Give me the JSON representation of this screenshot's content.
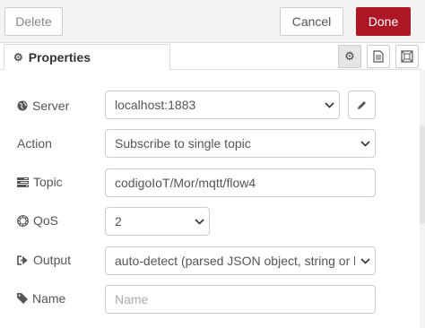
{
  "toolbar": {
    "delete_label": "Delete",
    "cancel_label": "Cancel",
    "done_label": "Done"
  },
  "tabs": {
    "properties_label": "Properties",
    "icons": [
      "gear-icon",
      "description-icon",
      "appearance-icon"
    ]
  },
  "form": {
    "server": {
      "label": "Server",
      "value": "localhost:1883",
      "icon": "globe-icon"
    },
    "action": {
      "label": "Action",
      "value": "Subscribe to single topic"
    },
    "topic": {
      "label": "Topic",
      "value": "codigoIoT/Mor/mqtt/flow4",
      "icon": "tasks-icon"
    },
    "qos": {
      "label": "QoS",
      "value": "2",
      "icon": "empire-icon"
    },
    "output": {
      "label": "Output",
      "value": "auto-detect (parsed JSON object, string or buffer)",
      "icon": "sign-out-icon"
    },
    "name": {
      "label": "Name",
      "placeholder": "Name",
      "value": "",
      "icon": "tag-icon"
    }
  },
  "colors": {
    "done_button": "#ad1625",
    "toolbar_bg": "#f3f3f3",
    "border": "#cccccc"
  }
}
